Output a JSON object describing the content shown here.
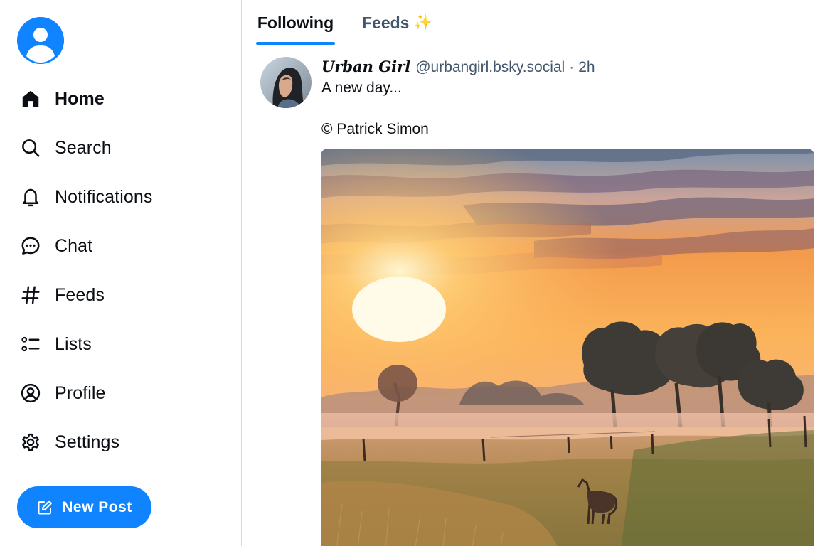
{
  "sidebar": {
    "nav": [
      {
        "label": "Home",
        "icon": "home-icon",
        "active": true
      },
      {
        "label": "Search",
        "icon": "search-icon",
        "active": false
      },
      {
        "label": "Notifications",
        "icon": "bell-icon",
        "active": false
      },
      {
        "label": "Chat",
        "icon": "chat-icon",
        "active": false
      },
      {
        "label": "Feeds",
        "icon": "hashtag-icon",
        "active": false
      },
      {
        "label": "Lists",
        "icon": "list-icon",
        "active": false
      },
      {
        "label": "Profile",
        "icon": "profile-icon",
        "active": false
      },
      {
        "label": "Settings",
        "icon": "gear-icon",
        "active": false
      }
    ],
    "new_post_label": "New Post"
  },
  "tabs": [
    {
      "label": "Following",
      "active": true
    },
    {
      "label": "Feeds",
      "active": false,
      "suffix": "✨"
    }
  ],
  "post": {
    "author_name": "Urban Girl",
    "author_handle": "@urbangirl.bsky.social",
    "separator": "·",
    "time": "2h",
    "text_line1": "A new day...",
    "text_line2": "© Patrick Simon"
  },
  "colors": {
    "accent": "#1083fe",
    "text": "#0b0f14",
    "muted": "#42566c",
    "border": "#d4dbe2"
  }
}
